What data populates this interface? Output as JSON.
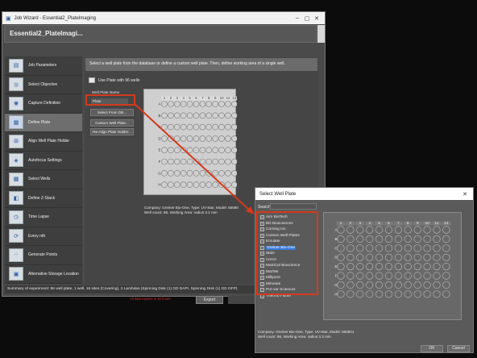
{
  "main_window": {
    "title": "Job Wizard - Essential2_PlateImaging",
    "app_header": "Essential2_PlateImagi...",
    "sidebar": [
      {
        "label": "Job Parameters",
        "icon": "clipboard-icon"
      },
      {
        "label": "Select Objective",
        "icon": "objective-icon"
      },
      {
        "label": "Capture Definition",
        "icon": "camera-icon"
      },
      {
        "label": "Define Plate",
        "icon": "plate-grid-icon",
        "active": true
      },
      {
        "label": "Align Well Plate Holder",
        "icon": "align-icon"
      },
      {
        "label": "Autofocus Settings",
        "icon": "autofocus-icon"
      },
      {
        "label": "Select Wells",
        "icon": "wells-icon"
      },
      {
        "label": "Define Z-Stack",
        "icon": "zstack-icon"
      },
      {
        "label": "Time Lapse",
        "icon": "stopwatch-icon"
      },
      {
        "label": "Every nth",
        "icon": "cycle-icon"
      },
      {
        "label": "Generate Points",
        "icon": "points-icon"
      },
      {
        "label": "Alternative Storage Location",
        "icon": "storage-icon"
      }
    ],
    "banner": "Select a well plate from the database or define a custom well plate.  Then, define working area of a single well.",
    "use_plate_label": "Use Plate with  96 wells",
    "well_plate_name_label": "Well Plate Name",
    "well_plate_name_value": "Plate",
    "buttons": {
      "select_from_db": "Select From DB...",
      "custom": "Custom Well Plate...",
      "realign": "Re-Align Plate Holder..."
    },
    "plate": {
      "columns": [
        "1",
        "2",
        "3",
        "4",
        "5",
        "6",
        "7",
        "8",
        "9",
        "10",
        "11",
        "12"
      ],
      "rows": [
        "A",
        "B",
        "C",
        "D",
        "E",
        "F",
        "G",
        "H"
      ]
    },
    "plate_info_line1": "Company: Greiner Bio-One, Type: UV-Star, Model: 65580",
    "plate_info_line2": "Well count: 96, Working Area: radius 3.2 mm",
    "summary": "Summary of experiment: 96 well plate, 1 well, 16 sites (Covering), 2 Lambdas (Spinning Disk (1) GD DAPI, Spinning Disk (1) GD GFP)",
    "warning": "All data expires in 48 hours",
    "export_label": "Export"
  },
  "dialog": {
    "title": "Select Well Plate",
    "close": "✕",
    "search_label": "Search:",
    "manufacturers": [
      "Aim BioTech",
      "BD Biosciences",
      "Corning Inc.",
      "Custom Well Plates",
      "Emulate",
      "Greiner Bio-One",
      "IBIDI",
      "IVIAO",
      "MatriCal Bioscience",
      "MatTek",
      "Millipore",
      "Mimetas",
      "Por-var Sciences",
      "Thermo Fisher"
    ],
    "selected_manufacturer": "Greiner Bio-One",
    "plate": {
      "columns": [
        "1",
        "2",
        "3",
        "4",
        "5",
        "6",
        "7",
        "8",
        "9",
        "10",
        "11",
        "12"
      ],
      "rows": [
        "A",
        "B",
        "C",
        "D",
        "E",
        "F",
        "G",
        "H"
      ]
    },
    "info_line1": "Company: Greiner Bio-One, Type: UV-Star, Model: 655801",
    "info_line2": "Well count: 96, Working Area: radius 3.3 mm",
    "ok_label": "OK",
    "cancel_label": "Cancel"
  },
  "colors": {
    "highlight": "#d43a1c",
    "selection": "#3a78d8"
  }
}
